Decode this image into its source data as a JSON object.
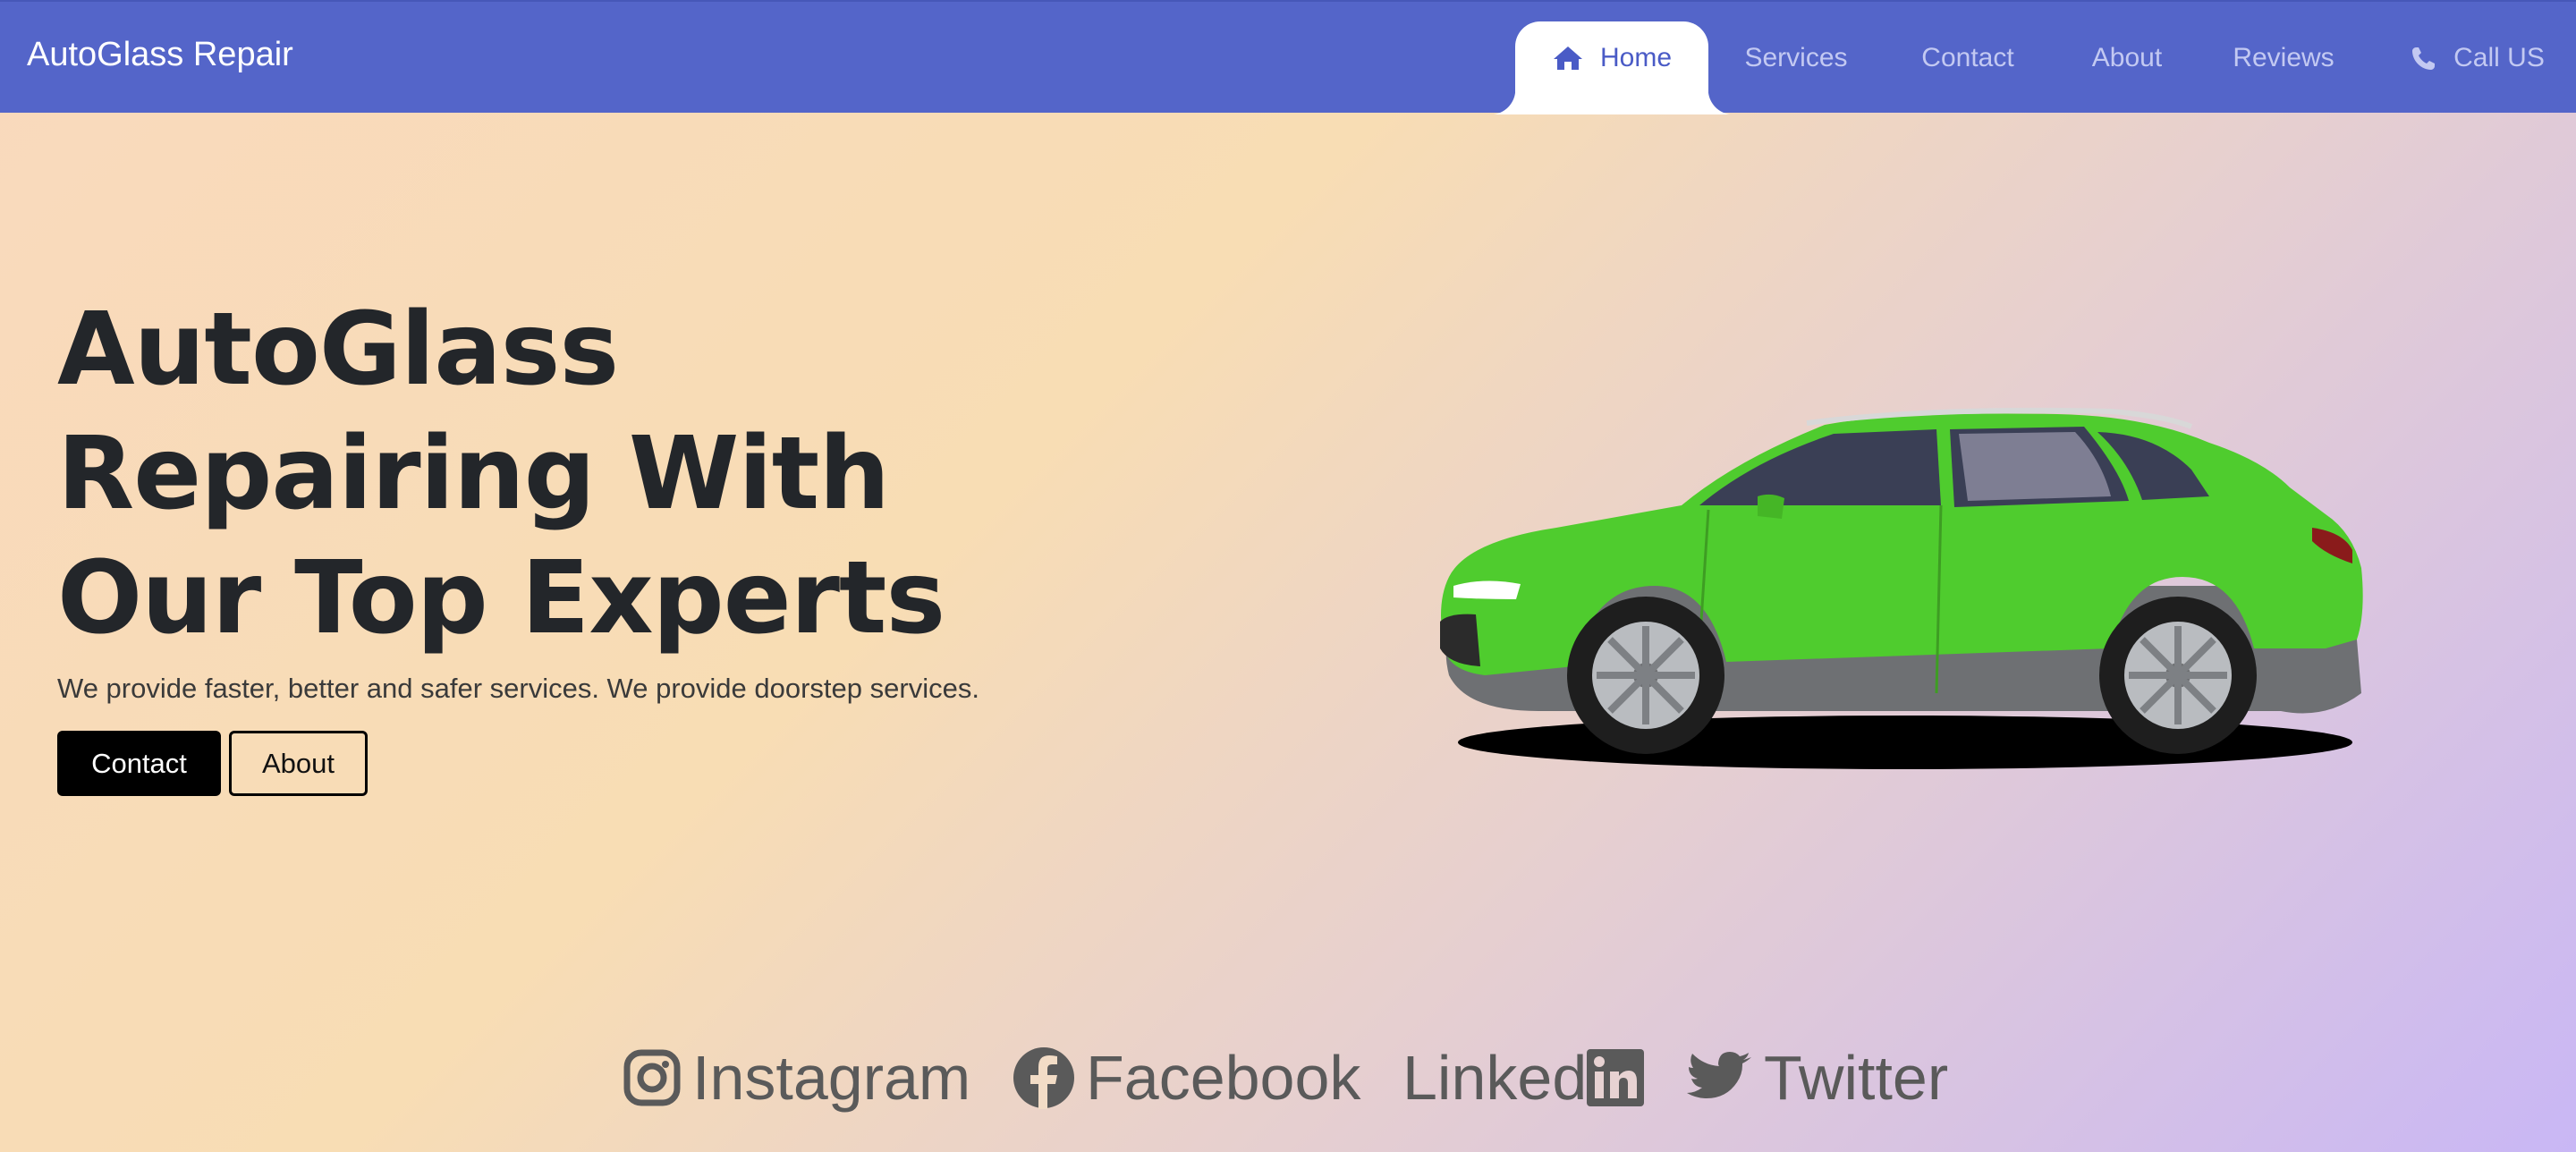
{
  "brand": "AutoGlass Repair",
  "nav": {
    "home": "Home",
    "services": "Services",
    "contact": "Contact",
    "about": "About",
    "reviews": "Reviews",
    "call": "Call US",
    "active": "home"
  },
  "hero": {
    "title_lines": [
      "AutoGlass",
      "Repairing With",
      "Our Top Experts"
    ],
    "subtitle": "We provide faster, better and safer services. We provide doorstep services.",
    "contact_button": "Contact",
    "about_button": "About"
  },
  "car_image": {
    "description_icon": "car-image",
    "color": "#4fcc2e"
  },
  "socials": {
    "instagram": "Instagram",
    "facebook": "Facebook",
    "linkedin_text": "Linked",
    "twitter": "Twitter"
  },
  "colors": {
    "navbar": "#5465c9",
    "nav_active_text": "#4a5bc6",
    "nav_text": "#c3c9f2",
    "title": "#23262a",
    "social": "#5a5a5a"
  }
}
